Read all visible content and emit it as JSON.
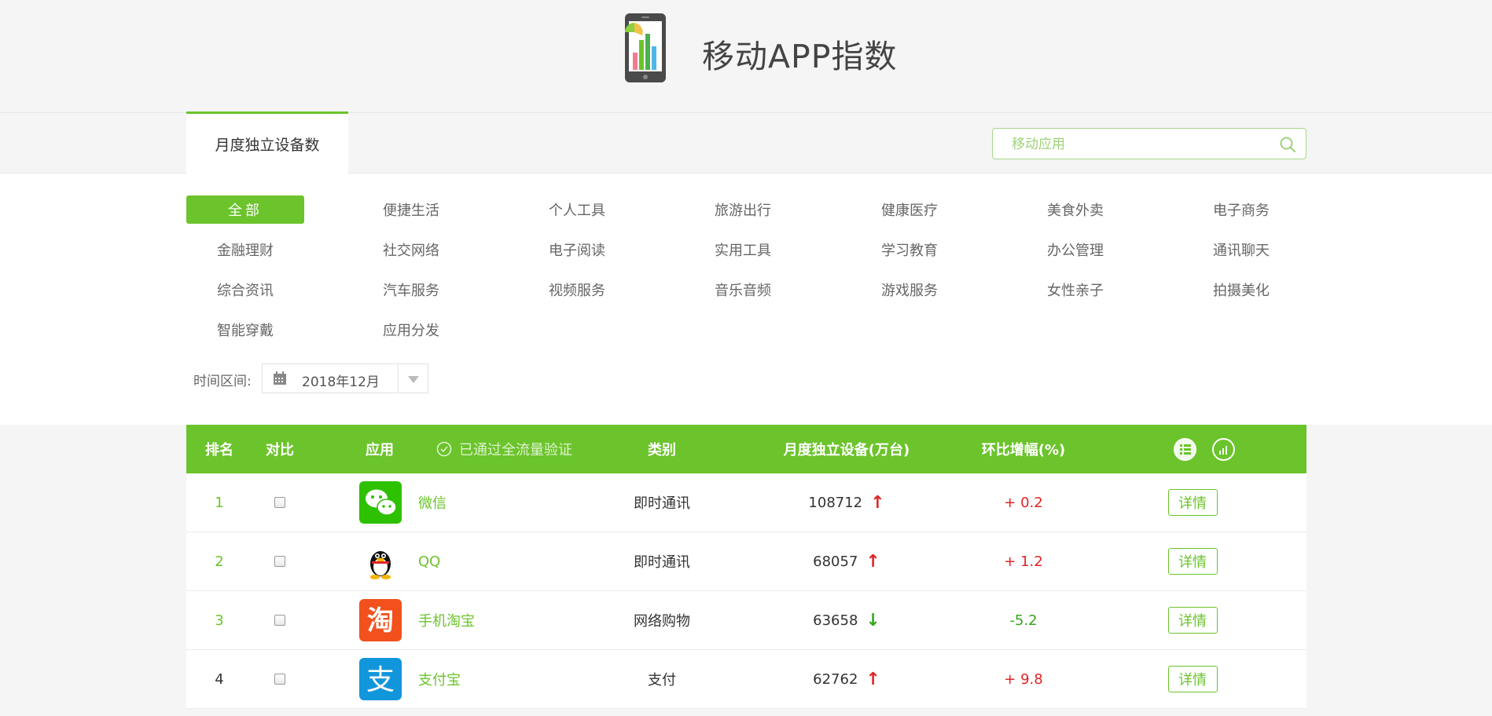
{
  "header": {
    "title": "移动APP指数"
  },
  "tabs": {
    "active_label": "月度独立设备数"
  },
  "search": {
    "placeholder": "移动应用"
  },
  "categories": [
    "全部",
    "便捷生活",
    "个人工具",
    "旅游出行",
    "健康医疗",
    "美食外卖",
    "电子商务",
    "金融理财",
    "社交网络",
    "电子阅读",
    "实用工具",
    "学习教育",
    "办公管理",
    "通讯聊天",
    "综合资讯",
    "汽车服务",
    "视频服务",
    "音乐音频",
    "游戏服务",
    "女性亲子",
    "拍摄美化",
    "智能穿戴",
    "应用分发"
  ],
  "filter": {
    "label": "时间区间:",
    "date": "2018年12月"
  },
  "table": {
    "headers": {
      "rank": "排名",
      "compare": "对比",
      "app": "应用",
      "verified": "已通过全流量验证",
      "category": "类别",
      "devices": "月度独立设备(万台)",
      "change": "环比增幅(%)"
    },
    "rows": [
      {
        "rank": "1",
        "name": "微信",
        "category": "即时通讯",
        "devices": "108712",
        "trend": "up",
        "change": "+ 0.2",
        "detail": "详情",
        "icon": "wechat-icon"
      },
      {
        "rank": "2",
        "name": "QQ",
        "category": "即时通讯",
        "devices": "68057",
        "trend": "up",
        "change": "+ 1.2",
        "detail": "详情",
        "icon": "qq-icon"
      },
      {
        "rank": "3",
        "name": "手机淘宝",
        "category": "网络购物",
        "devices": "63658",
        "trend": "down",
        "change": "-5.2",
        "detail": "详情",
        "icon": "taobao-icon"
      },
      {
        "rank": "4",
        "name": "支付宝",
        "category": "支付",
        "devices": "62762",
        "trend": "up",
        "change": "+ 9.8",
        "detail": "详情",
        "icon": "alipay-icon"
      }
    ]
  },
  "icons": {
    "taobao_glyph": "淘",
    "alipay_glyph": "支"
  },
  "colors": {
    "accent": "#6bc42b",
    "up": "#e02424",
    "down": "#35a51a"
  }
}
